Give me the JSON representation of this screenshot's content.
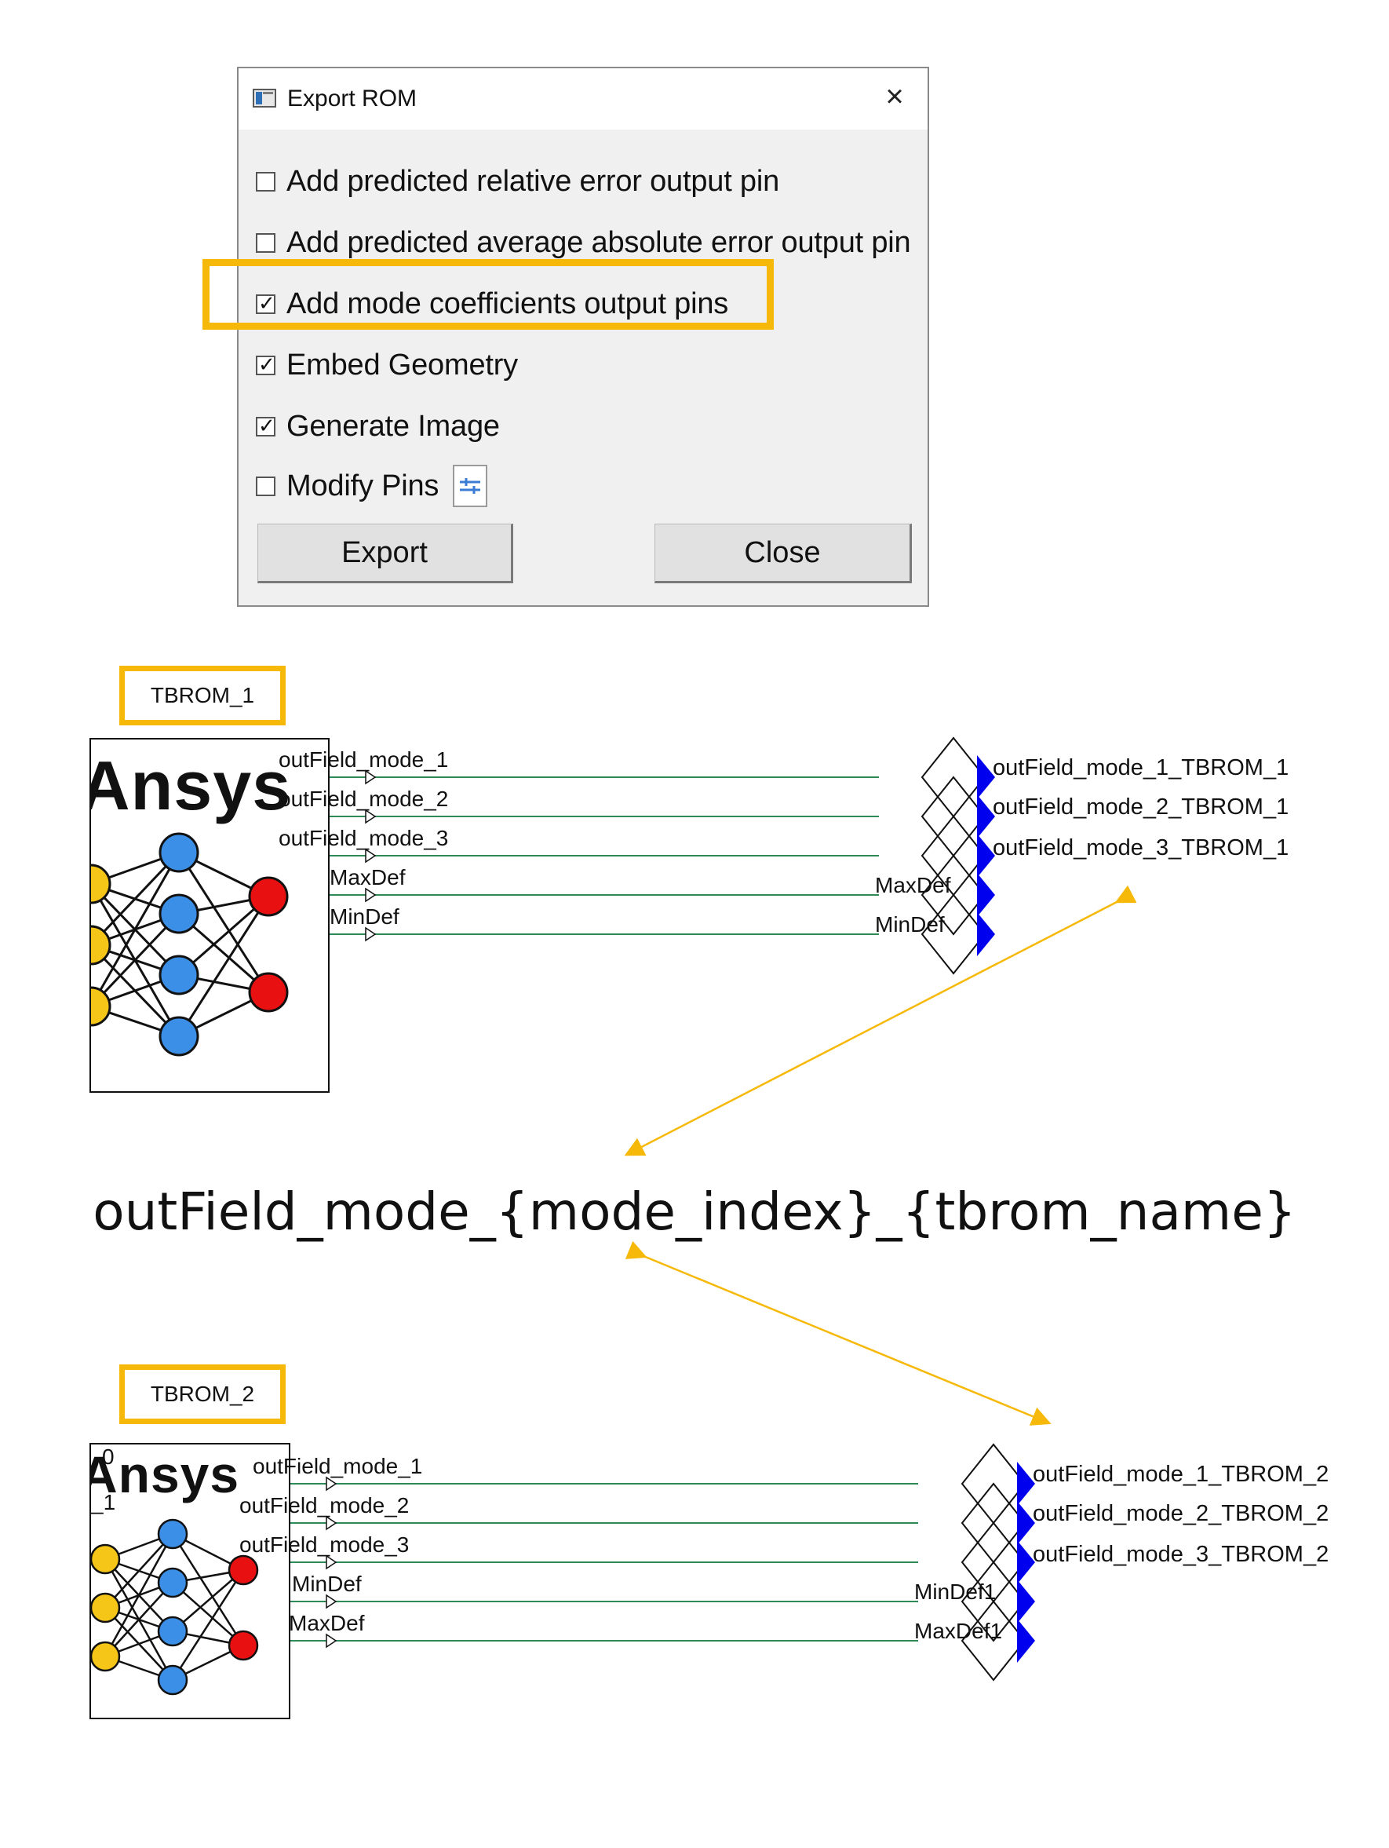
{
  "dialog": {
    "title": "Export ROM",
    "close_symbol": "×",
    "options": [
      {
        "label": "Add predicted relative error output pin",
        "checked": false
      },
      {
        "label": "Add predicted average absolute error output pin",
        "checked": false
      },
      {
        "label": "Add mode coefficients output pins",
        "checked": true,
        "highlighted": true
      },
      {
        "label": "Embed Geometry",
        "checked": true
      },
      {
        "label": "Generate Image",
        "checked": true
      },
      {
        "label": "Modify Pins",
        "checked": false
      }
    ],
    "buttons": {
      "export": "Export",
      "close": "Close"
    }
  },
  "blocks": [
    {
      "name": "TBROM_1",
      "brand": "Ansys",
      "inputs": [
        "outField_mode_1",
        "outField_mode_2",
        "outField_mode_3",
        "MaxDef",
        "MinDef"
      ],
      "outputs": [
        "outField_mode_1_TBROM_1",
        "outField_mode_2_TBROM_1",
        "outField_mode_3_TBROM_1"
      ],
      "sink_labels": [
        "MaxDef",
        "MinDef"
      ]
    },
    {
      "name": "TBROM_2",
      "brand": "Ansys",
      "clipped_marks": [
        "0",
        "_1"
      ],
      "inputs": [
        "outField_mode_1",
        "outField_mode_2",
        "outField_mode_3",
        "MinDef",
        "MaxDef"
      ],
      "outputs": [
        "outField_mode_1_TBROM_2",
        "outField_mode_2_TBROM_2",
        "outField_mode_3_TBROM_2"
      ],
      "sink_labels": [
        "MinDef1",
        "MaxDef1"
      ]
    }
  ],
  "formula": "outField_mode_{mode_index}_{tbrom_name}",
  "colors": {
    "highlight": "#f6b90a",
    "wire": "#2e8b57",
    "pin_arrow": "#0000ee",
    "node_input": "#f5c518",
    "node_hidden": "#3b8fe6",
    "node_output": "#e81010"
  }
}
